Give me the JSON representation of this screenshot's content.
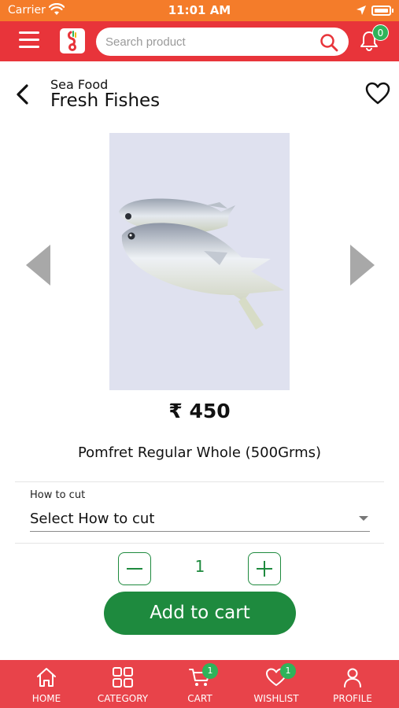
{
  "status_bar": {
    "carrier": "Carrier",
    "time": "11:01 AM"
  },
  "header": {
    "search_placeholder": "Search product",
    "notification_count": "0"
  },
  "page": {
    "category": "Sea Food",
    "title": "Fresh Fishes"
  },
  "product": {
    "price": "₹ 450",
    "name": "Pomfret Regular Whole (500Grms)",
    "image_bg": "#dfe1ef"
  },
  "cut_option": {
    "label": "How to cut",
    "selected": "Select How to cut"
  },
  "quantity": {
    "value": "1"
  },
  "add_to_cart_label": "Add to cart",
  "bottom_nav": [
    {
      "label": "HOME",
      "icon": "home-icon"
    },
    {
      "label": "CATEGORY",
      "icon": "grid-icon"
    },
    {
      "label": "CART",
      "icon": "cart-icon",
      "badge": "1"
    },
    {
      "label": "WISHLIST",
      "icon": "heart-icon",
      "badge": "1"
    },
    {
      "label": "PROFILE",
      "icon": "user-icon"
    }
  ],
  "colors": {
    "status_bar": "#f47c2a",
    "header": "#e8343a",
    "bottom_nav": "#e8434a",
    "accent_green": "#1e8a3e",
    "badge_green": "#2fb35a"
  }
}
